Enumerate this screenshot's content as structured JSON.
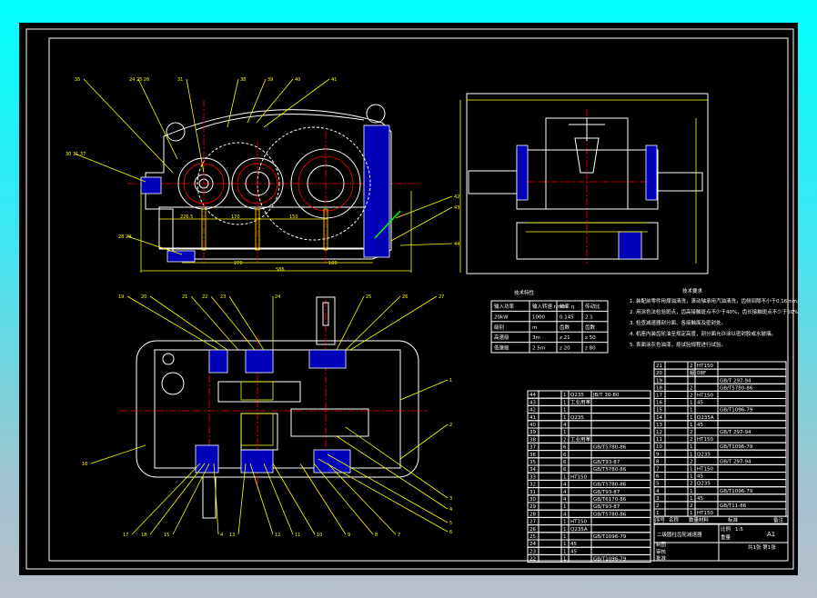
{
  "colors": {
    "background": "#000000",
    "outline": "#ffffff",
    "dimension": "#ffff00",
    "centerline": "#ff0000",
    "section": "#0000b8",
    "window_frame": "#00ffff"
  },
  "front_view": {
    "leaders": [
      "35",
      "24 25 26",
      "31",
      "38",
      "39",
      "40",
      "41",
      "30 31 37",
      "28 29",
      "42",
      "43",
      "44"
    ],
    "dimensions": [
      "226.5",
      "170",
      "150",
      "270",
      "160",
      "586"
    ]
  },
  "plan_view": {
    "leaders_top": [
      "19",
      "20",
      "21",
      "22",
      "23",
      "24",
      "25",
      "26",
      "27"
    ],
    "leaders_right": [
      "1",
      "2",
      "3",
      "4",
      "5",
      "6"
    ],
    "leaders_bottom": [
      "17",
      "18",
      "15",
      "4",
      "13",
      "12",
      "11",
      "10",
      "9",
      "8",
      "7"
    ],
    "leaders_left": [
      "16"
    ]
  },
  "tech_table": {
    "title": "技术特性",
    "headers": [
      "输入功率",
      "输入转速 r/min",
      "效率 η",
      "传动比"
    ],
    "rows": [
      [
        "20kW",
        "1000",
        "0.145",
        "2.1"
      ],
      [
        "级别",
        "m",
        "齿数",
        "齿数"
      ],
      [
        "高速级",
        "3m",
        "z 21",
        "z 50"
      ],
      [
        "低速级",
        "2.5m",
        "z 20",
        "z 80"
      ]
    ]
  },
  "notes": {
    "title": "技术要求",
    "items": [
      "1. 装配前零件用煤油清洗，滚动轴承用汽油清洗，齿侧间隙不小于0.16mm。",
      "2. 用涂色法检验斑点，齿高接触斑点不少于40%，齿长接触斑点不少于50%。",
      "3. 检查减速器剖分面、各接触面及密封处。",
      "4. 机座内装齿轮油至规定高度，剖分面允许涂以密封胶或水玻璃。",
      "5. 表面涂灰色油漆，按试验规程进行试验。"
    ]
  },
  "parts_left": [
    {
      "no": "44",
      "qty": "1",
      "mat": "Q235",
      "std": "JB/T 30-80"
    },
    {
      "no": "43",
      "qty": "1",
      "mat": "工业用革",
      "std": ""
    },
    {
      "no": "42",
      "qty": "1",
      "mat": "",
      "std": ""
    },
    {
      "no": "41",
      "qty": "1",
      "mat": "Q235",
      "std": ""
    },
    {
      "no": "40",
      "qty": "4",
      "mat": "",
      "std": ""
    },
    {
      "no": "39",
      "qty": "1",
      "mat": "",
      "std": ""
    },
    {
      "no": "38",
      "qty": "2",
      "mat": "工业用革",
      "std": ""
    },
    {
      "no": "37",
      "qty": "6",
      "mat": "",
      "std": "GB/T5780-86"
    },
    {
      "no": "36",
      "qty": "6",
      "mat": "",
      "std": ""
    },
    {
      "no": "35",
      "qty": "6",
      "mat": "",
      "std": "GB/T93-87"
    },
    {
      "no": "34",
      "qty": "6",
      "mat": "",
      "std": "GB/T5780-86"
    },
    {
      "no": "33",
      "qty": "1",
      "mat": "HT150",
      "std": ""
    },
    {
      "no": "32",
      "qty": "4",
      "mat": "",
      "std": "GB/T5780-86"
    },
    {
      "no": "31",
      "qty": "4",
      "mat": "",
      "std": "GB/T93-87"
    },
    {
      "no": "30",
      "qty": "4",
      "mat": "",
      "std": "GB/T6170-86"
    },
    {
      "no": "29",
      "qty": "1",
      "mat": "",
      "std": "GB/T93-87"
    },
    {
      "no": "28",
      "qty": "4",
      "mat": "",
      "std": "GB/T5780-86"
    },
    {
      "no": "27",
      "qty": "1",
      "mat": "HT150",
      "std": ""
    },
    {
      "no": "26",
      "qty": "1",
      "mat": "Q235A",
      "std": ""
    },
    {
      "no": "25",
      "qty": "1",
      "mat": "",
      "std": "GB/T1096-79"
    },
    {
      "no": "24",
      "qty": "1",
      "mat": "45",
      "std": ""
    },
    {
      "no": "23",
      "qty": "1",
      "mat": "45",
      "std": ""
    },
    {
      "no": "22",
      "qty": "1",
      "mat": "",
      "std": "GB/T1096-79"
    }
  ],
  "parts_right": [
    {
      "no": "21",
      "qty": "2",
      "mat": "HT150",
      "std": ""
    },
    {
      "no": "20",
      "qty": "組",
      "mat": "08F",
      "std": ""
    },
    {
      "no": "19",
      "qty": "",
      "mat": "",
      "std": "GB/T 297-94"
    },
    {
      "no": "18",
      "qty": "2",
      "mat": "",
      "std": "GB/T5780-86"
    },
    {
      "no": "17",
      "qty": "2",
      "mat": "HT150",
      "std": ""
    },
    {
      "no": "16",
      "qty": "1",
      "mat": "45",
      "std": ""
    },
    {
      "no": "15",
      "qty": "1",
      "mat": "",
      "std": "GB/T1096-79"
    },
    {
      "no": "14",
      "qty": "1",
      "mat": "Q235A",
      "std": ""
    },
    {
      "no": "13",
      "qty": "1",
      "mat": "45",
      "std": ""
    },
    {
      "no": "12",
      "qty": "2",
      "mat": "",
      "std": "GB/T 297-94"
    },
    {
      "no": "11",
      "qty": "2",
      "mat": "HT150",
      "std": ""
    },
    {
      "no": "10",
      "qty": "1",
      "mat": "",
      "std": "GB/T1096-79"
    },
    {
      "no": "9",
      "qty": "1",
      "mat": "Q235",
      "std": ""
    },
    {
      "no": "8",
      "qty": "2",
      "mat": "",
      "std": "GB/T 297-94"
    },
    {
      "no": "7",
      "qty": "1",
      "mat": "HT150",
      "std": ""
    },
    {
      "no": "6",
      "qty": "1",
      "mat": "45",
      "std": ""
    },
    {
      "no": "5",
      "qty": "2",
      "mat": "Q235",
      "std": ""
    },
    {
      "no": "4",
      "qty": "1",
      "mat": "",
      "std": "GB/T1096-79"
    },
    {
      "no": "3",
      "qty": "1",
      "mat": "45",
      "std": ""
    },
    {
      "no": "2",
      "qty": "2",
      "mat": "",
      "std": "GB/T11-86"
    },
    {
      "no": "1",
      "qty": "1",
      "mat": "HT150",
      "std": ""
    }
  ],
  "parts_header": {
    "no": "序号",
    "name": "名称",
    "qty": "数量",
    "mat": "材料",
    "std": "标准",
    "note": "备注"
  },
  "title_block": {
    "title": "二级圆柱齿轮减速器",
    "scale_label": "比例",
    "scale": "1:5",
    "sheet": "A1",
    "sheet_count": "共1张 第1张",
    "drawn": "制图",
    "checked": "审核",
    "approved": "批准",
    "weight_label": "重量"
  }
}
